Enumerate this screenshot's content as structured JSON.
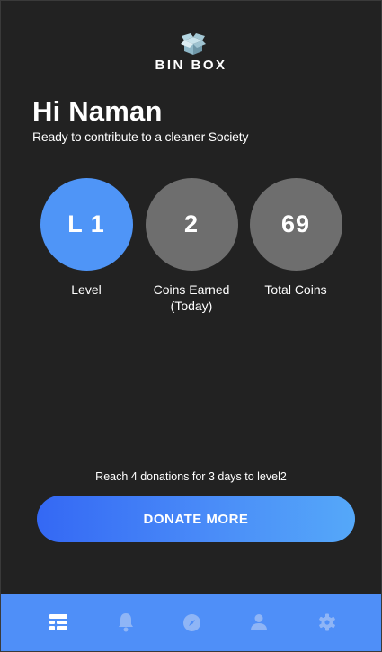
{
  "app": {
    "brand": "BIN BOX"
  },
  "header": {
    "greeting": "Hi Naman",
    "subtitle": "Ready to contribute to a cleaner Society"
  },
  "stats": [
    {
      "value": "L 1",
      "label": "Level",
      "color": "#4f95f7"
    },
    {
      "value": "2",
      "label": "Coins Earned\n(Today)",
      "color": "#6e6e6e"
    },
    {
      "value": "69",
      "label": "Total Coins",
      "color": "#6e6e6e"
    }
  ],
  "hint": "Reach 4 donations for 3 days to level2",
  "donate_button": {
    "label": "DONATE MORE"
  },
  "navbar": {
    "color": "#4f8ff8",
    "items": [
      {
        "icon": "dashboard-icon",
        "active": true
      },
      {
        "icon": "bell-icon",
        "active": false
      },
      {
        "icon": "compass-icon",
        "active": false
      },
      {
        "icon": "profile-icon",
        "active": false
      },
      {
        "icon": "gear-icon",
        "active": false
      }
    ]
  }
}
